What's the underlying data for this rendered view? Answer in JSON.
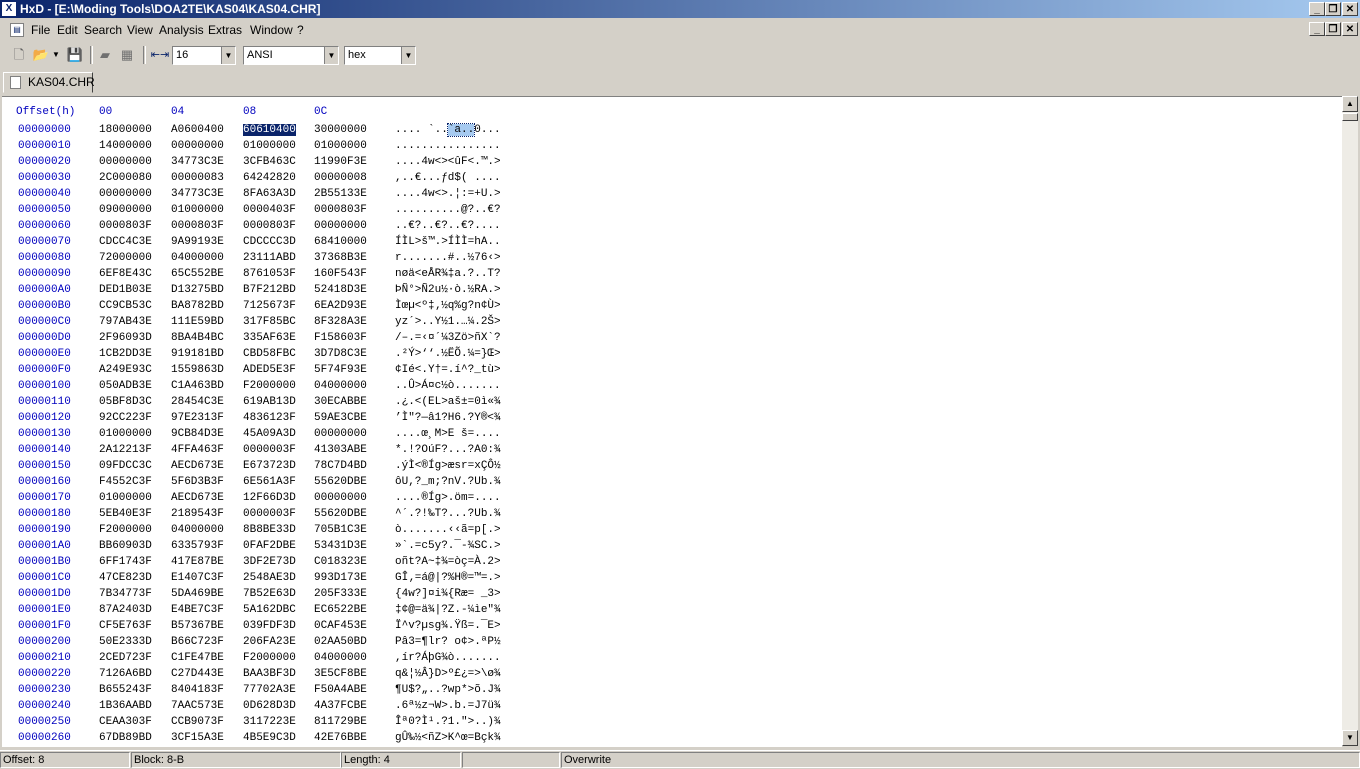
{
  "window": {
    "app_icon": "hxd-icon",
    "title": "HxD - [E:\\Moding Tools\\DOA2TE\\KAS04\\KAS04.CHR]",
    "controls": [
      "minimize-icon",
      "restore-icon",
      "close-icon"
    ]
  },
  "menu": {
    "items": [
      "File",
      "Edit",
      "Search",
      "View",
      "Analysis",
      "Extras",
      "Window",
      "?"
    ]
  },
  "toolbar": {
    "bytes_per_row": "16",
    "charset": "ANSI",
    "offset_base": "hex",
    "icons": [
      "new-file-icon",
      "open-file-icon",
      "save-icon",
      "open-disk-icon",
      "open-ram-icon",
      "bytes-per-row-icon"
    ]
  },
  "tabs": [
    {
      "label": "KAS04.CHR"
    }
  ],
  "editor": {
    "header": {
      "offset": "Offset(h)",
      "cols": [
        "00",
        "04",
        "08",
        "0C"
      ]
    },
    "selected_group": "60610400",
    "ascii_highlight": "`a..",
    "rows": [
      {
        "offset": "00000000",
        "groups": [
          "18000000",
          "A0600400",
          "60610400",
          "30000000"
        ],
        "ascii": ".... `..`a..0..."
      },
      {
        "offset": "00000010",
        "groups": [
          "14000000",
          "00000000",
          "01000000",
          "01000000"
        ],
        "ascii": "................"
      },
      {
        "offset": "00000020",
        "groups": [
          "00000000",
          "34773C3E",
          "3CFB463C",
          "11990F3E"
        ],
        "ascii": "....4w<><ûF<.™.>"
      },
      {
        "offset": "00000030",
        "groups": [
          "2C000080",
          "00000083",
          "64242820",
          "00000008"
        ],
        "ascii": ",..€...ƒd$( ...."
      },
      {
        "offset": "00000040",
        "groups": [
          "00000000",
          "34773C3E",
          "8FA63A3D",
          "2B55133E"
        ],
        "ascii": "....4w<>.¦:=+U.>"
      },
      {
        "offset": "00000050",
        "groups": [
          "09000000",
          "01000000",
          "0000403F",
          "0000803F"
        ],
        "ascii": "..........@?..€?"
      },
      {
        "offset": "00000060",
        "groups": [
          "0000803F",
          "0000803F",
          "0000803F",
          "00000000"
        ],
        "ascii": "..€?..€?..€?...."
      },
      {
        "offset": "00000070",
        "groups": [
          "CDCC4C3E",
          "9A99193E",
          "CDCCCC3D",
          "68410000"
        ],
        "ascii": "ÍÌL>š™.>ÍÌÌ=hA.."
      },
      {
        "offset": "00000080",
        "groups": [
          "72000000",
          "04000000",
          "23111ABD",
          "37368B3E"
        ],
        "ascii": "r.......#..½76‹>"
      },
      {
        "offset": "00000090",
        "groups": [
          "6EF8E43C",
          "65C552BE",
          "8761053F",
          "160F543F"
        ],
        "ascii": "nøä<eÅR¾‡a.?..T?"
      },
      {
        "offset": "000000A0",
        "groups": [
          "DED1B03E",
          "D13275BD",
          "B7F212BD",
          "52418D3E"
        ],
        "ascii": "ÞÑ°>Ñ2u½·ò.½RA.>"
      },
      {
        "offset": "000000B0",
        "groups": [
          "CC9CB53C",
          "BA8782BD",
          "7125673F",
          "6EA2D93E"
        ],
        "ascii": "Ìœµ<º‡‚½q%g?n¢Ù>"
      },
      {
        "offset": "000000C0",
        "groups": [
          "797AB43E",
          "111E59BD",
          "317F85BC",
          "8F328A3E"
        ],
        "ascii": "yz´>..Y½1.…¼.2Š>"
      },
      {
        "offset": "000000D0",
        "groups": [
          "2F96093D",
          "8BA4B4BC",
          "335AF63E",
          "F158603F"
        ],
        "ascii": "/–.=‹¤´¼3Zö>ñX`?"
      },
      {
        "offset": "000000E0",
        "groups": [
          "1CB2DD3E",
          "919181BD",
          "CBD58FBC",
          "3D7D8C3E"
        ],
        "ascii": ".²Ý>‘‘.½ËÕ.¼=}Œ>"
      },
      {
        "offset": "000000F0",
        "groups": [
          "A249E93C",
          "1559863D",
          "ADED5E3F",
          "5F74F93E"
        ],
        "ascii": "¢Ié<.Y†=.í^?_tù>"
      },
      {
        "offset": "00000100",
        "groups": [
          "050ADB3E",
          "C1A463BD",
          "F2000000",
          "04000000"
        ],
        "ascii": "..Û>Á¤c½ò......."
      },
      {
        "offset": "00000110",
        "groups": [
          "05BF8D3C",
          "28454C3E",
          "619AB13D",
          "30ECABBE"
        ],
        "ascii": ".¿.<(EL>aš±=0ì«¾"
      },
      {
        "offset": "00000120",
        "groups": [
          "92CC223F",
          "97E2313F",
          "4836123F",
          "59AE3CBE"
        ],
        "ascii": "’Ì\"?—â1?H6.?Y®<¾"
      },
      {
        "offset": "00000130",
        "groups": [
          "01000000",
          "9CB84D3E",
          "45A09A3D",
          "00000000"
        ],
        "ascii": "....œ¸M>E š=...."
      },
      {
        "offset": "00000140",
        "groups": [
          "2A12213F",
          "4FFA463F",
          "0000003F",
          "41303ABE"
        ],
        "ascii": "*.!?OúF?...?A0:¾"
      },
      {
        "offset": "00000150",
        "groups": [
          "09FDCC3C",
          "AECD673E",
          "E673723D",
          "78C7D4BD"
        ],
        "ascii": ".ýÌ<®Íg>æsr=xÇÔ½"
      },
      {
        "offset": "00000160",
        "groups": [
          "F4552C3F",
          "5F6D3B3F",
          "6E561A3F",
          "55620DBE"
        ],
        "ascii": "ôU,?_m;?nV.?Ub.¾"
      },
      {
        "offset": "00000170",
        "groups": [
          "01000000",
          "AECD673E",
          "12F66D3D",
          "00000000"
        ],
        "ascii": "....®Íg>.öm=...."
      },
      {
        "offset": "00000180",
        "groups": [
          "5EB40E3F",
          "2189543F",
          "0000003F",
          "55620DBE"
        ],
        "ascii": "^´.?!‰T?...?Ub.¾"
      },
      {
        "offset": "00000190",
        "groups": [
          "F2000000",
          "04000000",
          "8B8BE33D",
          "705B1C3E"
        ],
        "ascii": "ò.......‹‹ã=p[.>"
      },
      {
        "offset": "000001A0",
        "groups": [
          "BB60903D",
          "6335793F",
          "0FAF2DBE",
          "53431D3E"
        ],
        "ascii": "»`.=c5y?.¯-¾SC.>"
      },
      {
        "offset": "000001B0",
        "groups": [
          "6FF1743F",
          "417E87BE",
          "3DF2E73D",
          "C018323E"
        ],
        "ascii": "oñt?A~‡¾=òç=À.2>"
      },
      {
        "offset": "000001C0",
        "groups": [
          "47CE823D",
          "E1407C3F",
          "2548AE3D",
          "993D173E"
        ],
        "ascii": "GÎ‚=á@|?%H®=™=.>"
      },
      {
        "offset": "000001D0",
        "groups": [
          "7B34773F",
          "5DA469BE",
          "7B52E63D",
          "205F333E"
        ],
        "ascii": "{4w?]¤i¾{Ræ= _3>"
      },
      {
        "offset": "000001E0",
        "groups": [
          "87A2403D",
          "E4BE7C3F",
          "5A162DBC",
          "EC6522BE"
        ],
        "ascii": "‡¢@=ä¾|?Z.-¼ìe\"¾"
      },
      {
        "offset": "000001F0",
        "groups": [
          "CF5E763F",
          "B57367BE",
          "039FDF3D",
          "0CAF453E"
        ],
        "ascii": "Ï^v?µsg¾.Ÿß=.¯E>"
      },
      {
        "offset": "00000200",
        "groups": [
          "50E2333D",
          "B66C723F",
          "206FA23E",
          "02AA50BD"
        ],
        "ascii": "Pâ3=¶lr? o¢>.ªP½"
      },
      {
        "offset": "00000210",
        "groups": [
          "2CED723F",
          "C1FE47BE",
          "F2000000",
          "04000000"
        ],
        "ascii": ",ír?ÁþG¾ò......."
      },
      {
        "offset": "00000220",
        "groups": [
          "7126A6BD",
          "C27D443E",
          "BAA3BF3D",
          "3E5CF8BE"
        ],
        "ascii": "q&¦½Â}D>º£¿=>\\ø¾"
      },
      {
        "offset": "00000230",
        "groups": [
          "B655243F",
          "8404183F",
          "77702A3E",
          "F50A4ABE"
        ],
        "ascii": "¶U$?„..?wp*>õ.J¾"
      },
      {
        "offset": "00000240",
        "groups": [
          "1B36AABD",
          "7AAC573E",
          "0D628D3D",
          "4A37FCBE"
        ],
        "ascii": ".6ª½z¬W>.b.=J7ü¾"
      },
      {
        "offset": "00000250",
        "groups": [
          "CEAA303F",
          "CCB9073F",
          "3117223E",
          "811729BE"
        ],
        "ascii": "Îª0?Ì¹.?1.\">..)¾"
      },
      {
        "offset": "00000260",
        "groups": [
          "67DB89BD",
          "3CF15A3E",
          "4B5E9C3D",
          "42E76BBE"
        ],
        "ascii": "gÛ‰½<ñZ>K^œ=Bçk¾"
      }
    ]
  },
  "status": {
    "offset": "Offset: 8",
    "block": "Block: 8-B",
    "length": "Length: 4",
    "empty": "",
    "mode": "Overwrite"
  }
}
